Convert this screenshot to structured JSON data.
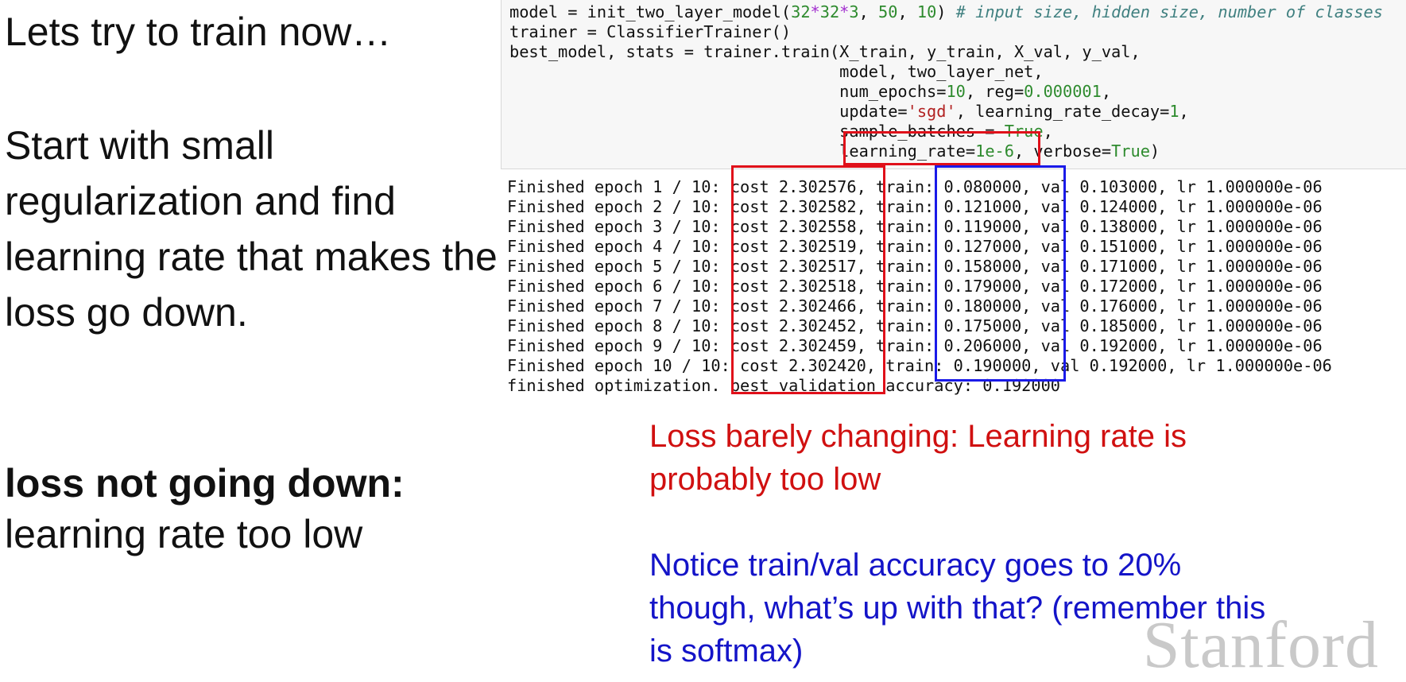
{
  "slide": {
    "title": "Lets try to train now…",
    "body": "Start with small regularization and find learning rate that makes the loss go down.",
    "conclusion_bold": "loss not going down:",
    "conclusion_text": "learning rate too low"
  },
  "code": {
    "line1": {
      "a": "model = init_two_layer_model(",
      "n1": "32",
      "o1": "*",
      "n2": "32",
      "o2": "*",
      "n3": "3",
      "b": ", ",
      "n4": "50",
      "c": ", ",
      "n5": "10",
      "d": ") ",
      "comment": "# input size, hidden size, number of classes"
    },
    "line2": "trainer = ClassifierTrainer()",
    "line3": "best_model, stats = trainer.train(X_train, y_train, X_val, y_val,",
    "line4": "                                  model, two_layer_net,",
    "line5": {
      "a": "                                  num_epochs=",
      "n1": "10",
      "b": ", reg=",
      "n2": "0.000001",
      "c": ","
    },
    "line6": {
      "a": "                                  update=",
      "s1": "'sgd'",
      "b": ", learning_rate_decay=",
      "n1": "1",
      "c": ","
    },
    "line7": {
      "a": "                                  sample_batches = ",
      "k1": "True",
      "c": ","
    },
    "line8": {
      "a": "                                  learning_rate=",
      "n1": "1e-6",
      "b": ", verbose=",
      "k1": "True",
      "c": ")"
    }
  },
  "output": {
    "lines": [
      "Finished epoch 1 / 10: cost 2.302576, train: 0.080000, val 0.103000, lr 1.000000e-06",
      "Finished epoch 2 / 10: cost 2.302582, train: 0.121000, val 0.124000, lr 1.000000e-06",
      "Finished epoch 3 / 10: cost 2.302558, train: 0.119000, val 0.138000, lr 1.000000e-06",
      "Finished epoch 4 / 10: cost 2.302519, train: 0.127000, val 0.151000, lr 1.000000e-06",
      "Finished epoch 5 / 10: cost 2.302517, train: 0.158000, val 0.171000, lr 1.000000e-06",
      "Finished epoch 6 / 10: cost 2.302518, train: 0.179000, val 0.172000, lr 1.000000e-06",
      "Finished epoch 7 / 10: cost 2.302466, train: 0.180000, val 0.176000, lr 1.000000e-06",
      "Finished epoch 8 / 10: cost 2.302452, train: 0.175000, val 0.185000, lr 1.000000e-06",
      "Finished epoch 9 / 10: cost 2.302459, train: 0.206000, val 0.192000, lr 1.000000e-06",
      "Finished epoch 10 / 10: cost 2.302420, train: 0.190000, val 0.192000, lr 1.000000e-06",
      "finished optimization. best validation accuracy: 0.192000"
    ]
  },
  "annotations": {
    "red_note": "Loss barely changing: Learning rate is probably too low",
    "blue_note": "Notice train/val accuracy goes to 20% though, what’s up with that? (remember this is softmax)"
  },
  "logo": "Stanford",
  "colors": {
    "red": "#e0101a",
    "blue": "#1a1ae8",
    "code_background": "#f7f7f7"
  }
}
